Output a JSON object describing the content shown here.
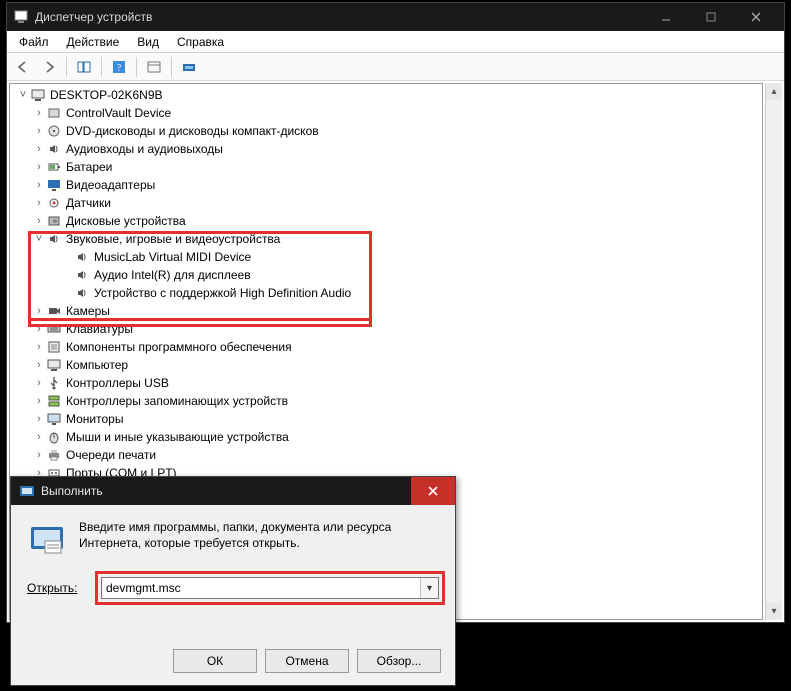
{
  "dm": {
    "title": "Диспетчер устройств",
    "menu": {
      "file": "Файл",
      "action": "Действие",
      "view": "Вид",
      "help": "Справка"
    },
    "root": "DESKTOP-02K6N9B",
    "cats": [
      {
        "label": "ControlVault Device"
      },
      {
        "label": "DVD-дисководы и дисководы компакт-дисков"
      },
      {
        "label": "Аудиовходы и аудиовыходы"
      },
      {
        "label": "Батареи"
      },
      {
        "label": "Видеоадаптеры"
      },
      {
        "label": "Датчики"
      },
      {
        "label": "Дисковые устройства"
      },
      {
        "label": "Звуковые, игровые и видеоустройства",
        "expanded": true,
        "children": [
          {
            "label": "MusicLab Virtual MIDI Device"
          },
          {
            "label": "Аудио Intel(R) для дисплеев"
          },
          {
            "label": "Устройство с поддержкой High Definition Audio"
          }
        ]
      },
      {
        "label": "Камеры"
      },
      {
        "label": "Клавиатуры"
      },
      {
        "label": "Компоненты программного обеспечения"
      },
      {
        "label": "Компьютер"
      },
      {
        "label": "Контроллеры USB"
      },
      {
        "label": "Контроллеры запоминающих устройств"
      },
      {
        "label": "Мониторы"
      },
      {
        "label": "Мыши и иные указывающие устройства"
      },
      {
        "label": "Очереди печати"
      },
      {
        "label": "Порты (COM и LPT)"
      }
    ]
  },
  "run": {
    "title": "Выполнить",
    "desc": "Введите имя программы, папки, документа или ресурса Интернета, которые требуется открыть.",
    "open_label": "Открыть:",
    "value": "devmgmt.msc",
    "ok": "ОК",
    "cancel": "Отмена",
    "browse": "Обзор..."
  }
}
